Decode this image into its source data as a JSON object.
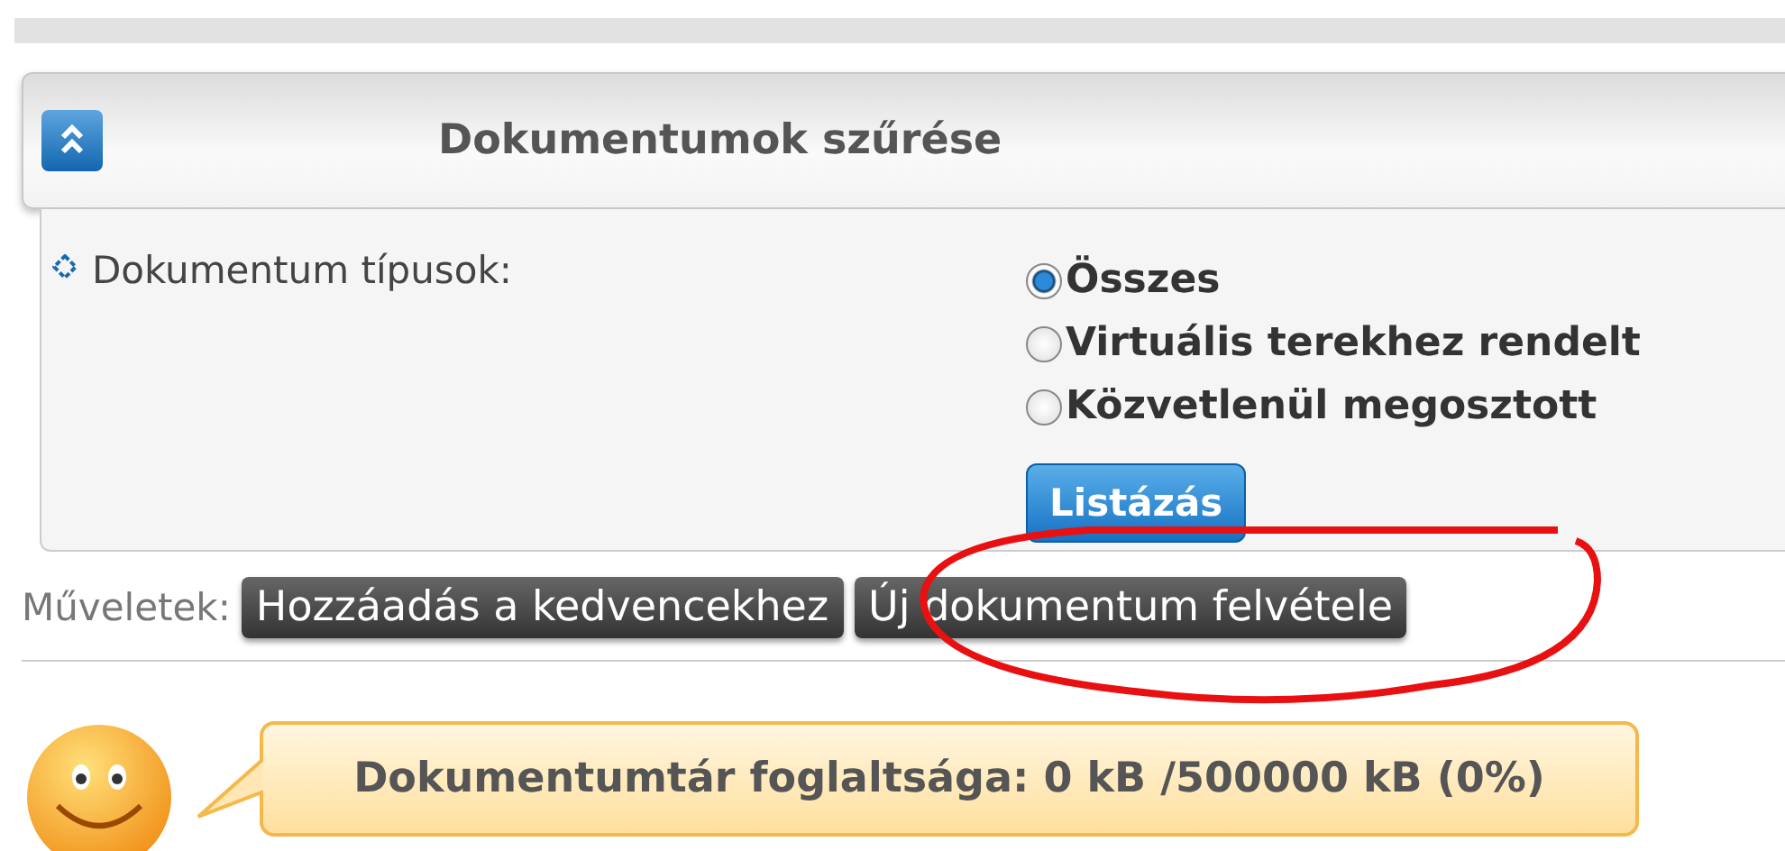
{
  "filter_panel": {
    "title": "Dokumentumok szűrése",
    "expanded": true,
    "field_label": "Dokumentum típusok:",
    "options": [
      {
        "label": "Összes",
        "selected": true
      },
      {
        "label": "Virtuális terekhez rendelt",
        "selected": false
      },
      {
        "label": "Közvetlenül megosztott",
        "selected": false
      }
    ],
    "list_button": "Listázás"
  },
  "actions": {
    "label": "Műveletek:",
    "buttons": [
      "Hozzáadás a kedvencekhez",
      "Új dokumentum felvétele"
    ]
  },
  "storage": {
    "message": "Dokumentumtár foglaltsága: 0 kB /500000 kB (0%)"
  }
}
